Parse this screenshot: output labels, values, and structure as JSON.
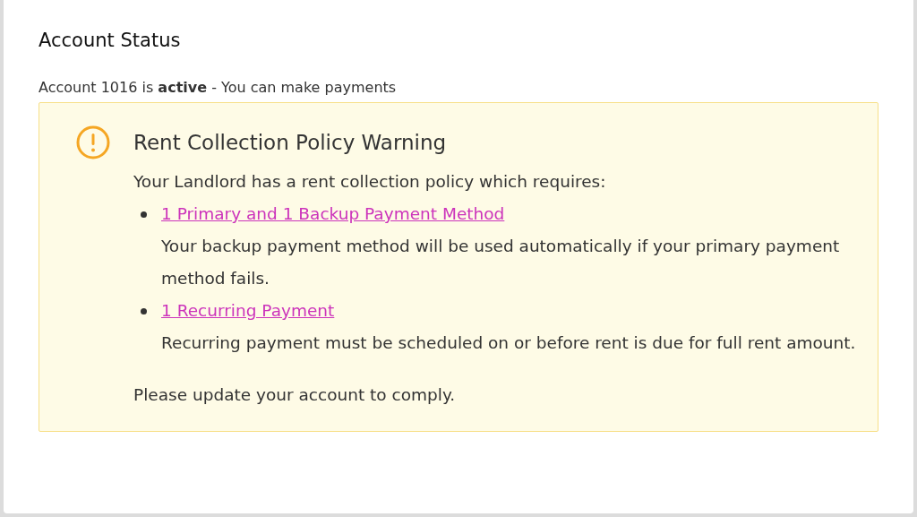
{
  "card": {
    "title": "Account Status",
    "status_line": "Account 1016 is **active** - You can make payments"
  },
  "warning": {
    "title": "Rent Collection Policy Warning",
    "intro": "Your Landlord has a rent collection policy which requires:",
    "requirements": [
      {
        "link": "1 Primary and 1 Backup Payment Method",
        "description": "Your backup payment method will be used automatically if your primary payment method fails."
      },
      {
        "link": "1 Recurring Payment",
        "description": "Recurring payment must be scheduled on or before rent is due for full rent amount."
      }
    ],
    "footer": "Please update your account to comply."
  }
}
